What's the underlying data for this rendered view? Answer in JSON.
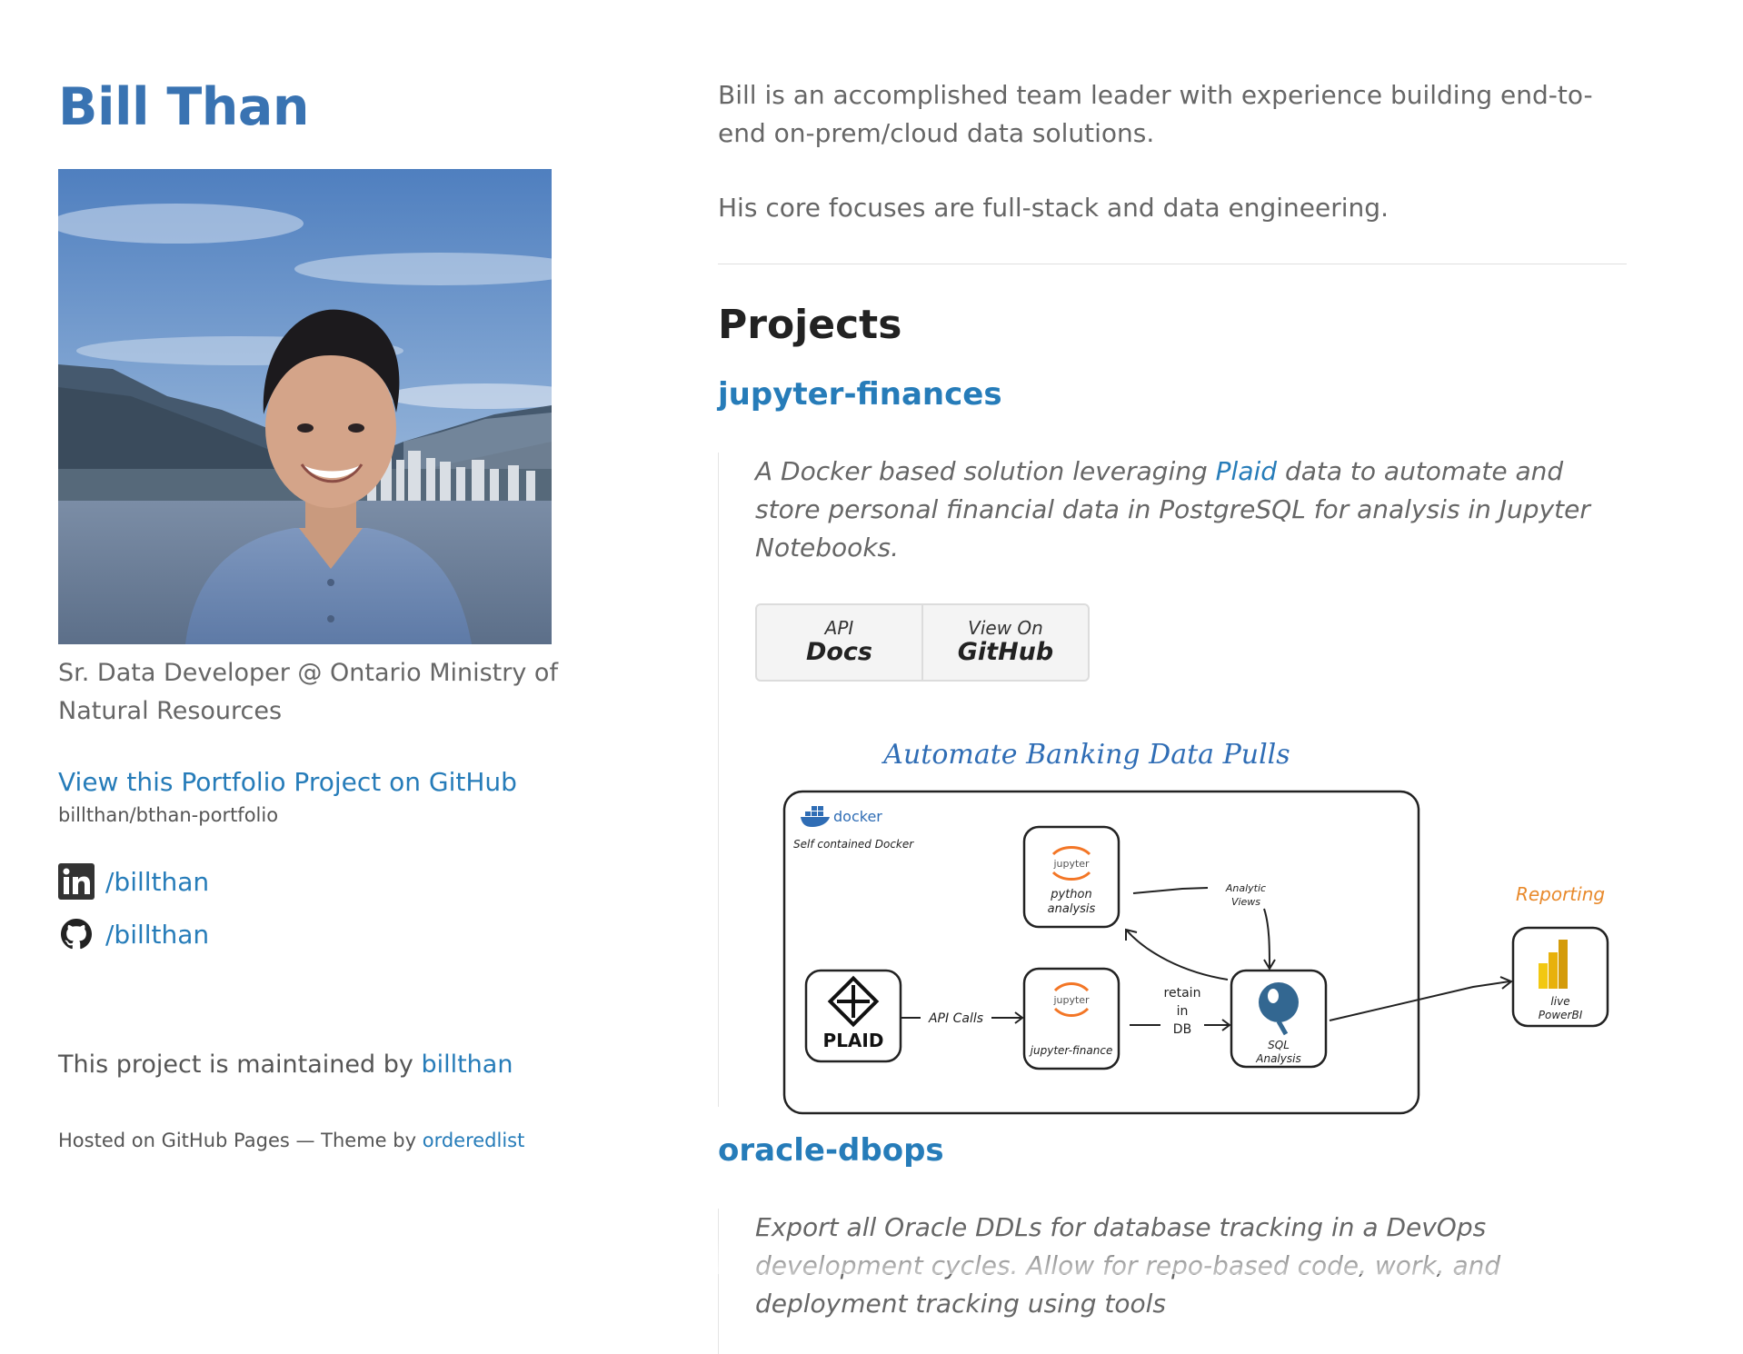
{
  "sidebar": {
    "title": "Bill Than",
    "tagline": "Sr. Data Developer @ Ontario Ministry of Natural Resources",
    "github_link_label": "View this Portfolio Project on GitHub",
    "github_repo": "billthan/bthan-portfolio",
    "linkedin_label": "/billthan",
    "github_label": "/billthan",
    "maintained_prefix": "This project is maintained by",
    "maintained_user": "billthan",
    "hosted_prefix": "Hosted on GitHub Pages — Theme by",
    "theme_author": "orderedlist"
  },
  "main": {
    "intro_1": "Bill is an accomplished team leader with experience building end-to-end on-prem/cloud data solutions.",
    "intro_2": "His core focuses are full-stack and data engineering.",
    "projects_heading": "Projects",
    "projects": [
      {
        "title": "jupyter-finances",
        "desc_before": "A Docker based solution leveraging",
        "desc_link": "Plaid",
        "desc_after": "data to automate and store personal financial data in PostgreSQL for analysis in Jupyter Notebooks.",
        "buttons": [
          {
            "small": "API",
            "big": "Docs"
          },
          {
            "small": "View On",
            "big": "GitHub"
          }
        ],
        "diagram": {
          "title": "Automate Banking Data Pulls",
          "docker_label": "docker",
          "docker_caption": "Self contained Docker",
          "node_python": [
            "python",
            "analysis"
          ],
          "node_finance": "jupyter-finance",
          "node_jupyter_logo": "jupyter",
          "node_plaid": "PLAID",
          "node_sql": [
            "SQL",
            "Analysis"
          ],
          "node_powerbi": [
            "live",
            "PowerBI"
          ],
          "edge_api": "API Calls",
          "edge_retain": [
            "retain",
            "in",
            "DB"
          ],
          "edge_views": [
            "Analytic",
            "Views"
          ],
          "reporting": "Reporting"
        }
      },
      {
        "title": "oracle-dbops",
        "desc": "Export all Oracle DDLs for database tracking in a DevOps development cycles. Allow for repo-based code, work, and deployment tracking using tools"
      }
    ]
  },
  "colors": {
    "link": "#267CB9",
    "title": "#3973B2",
    "reporting": "#E8892B",
    "diagram_title": "#2F6DB5"
  }
}
